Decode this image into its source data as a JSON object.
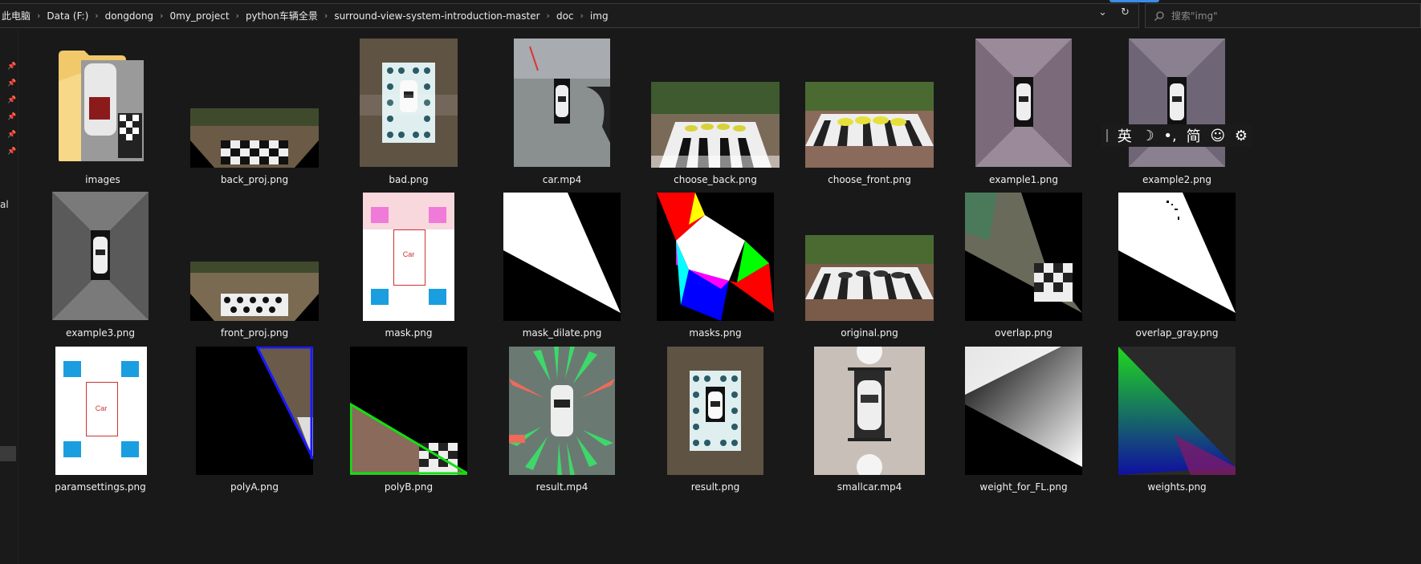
{
  "breadcrumb": [
    "此电脑",
    "Data (F:)",
    "dongdong",
    "0my_project",
    "python车辆全景",
    "surround-view-system-introduction-master",
    "doc",
    "img"
  ],
  "search": {
    "placeholder": "搜索\"img\""
  },
  "nav": {
    "partial_label": "al"
  },
  "ime_toolbar": {
    "lang": "英",
    "mode": "简"
  },
  "icons": {
    "dropdown": "chevron-down-icon",
    "refresh": "refresh-icon",
    "search": "search-icon",
    "pin": "pin-icon",
    "ime_moon": "moon-icon",
    "ime_punct": "punctuation-icon",
    "ime_emoji": "emoji-icon",
    "ime_settings": "gear-icon"
  },
  "files": [
    {
      "name": "images",
      "kind": "folder"
    },
    {
      "name": "back_proj.png"
    },
    {
      "name": "bad.png"
    },
    {
      "name": "car.mp4"
    },
    {
      "name": "choose_back.png"
    },
    {
      "name": "choose_front.png"
    },
    {
      "name": "example1.png"
    },
    {
      "name": "example2.png"
    },
    {
      "name": "example3.png"
    },
    {
      "name": "front_proj.png"
    },
    {
      "name": "mask.png",
      "thumb_text": "Car"
    },
    {
      "name": "mask_dilate.png"
    },
    {
      "name": "masks.png"
    },
    {
      "name": "original.png"
    },
    {
      "name": "overlap.png"
    },
    {
      "name": "overlap_gray.png"
    },
    {
      "name": "paramsettings.png",
      "thumb_text": "Car"
    },
    {
      "name": "polyA.png"
    },
    {
      "name": "polyB.png"
    },
    {
      "name": "result.mp4"
    },
    {
      "name": "result.png"
    },
    {
      "name": "smallcar.mp4"
    },
    {
      "name": "weight_for_FL.png"
    },
    {
      "name": "weights.png"
    }
  ]
}
